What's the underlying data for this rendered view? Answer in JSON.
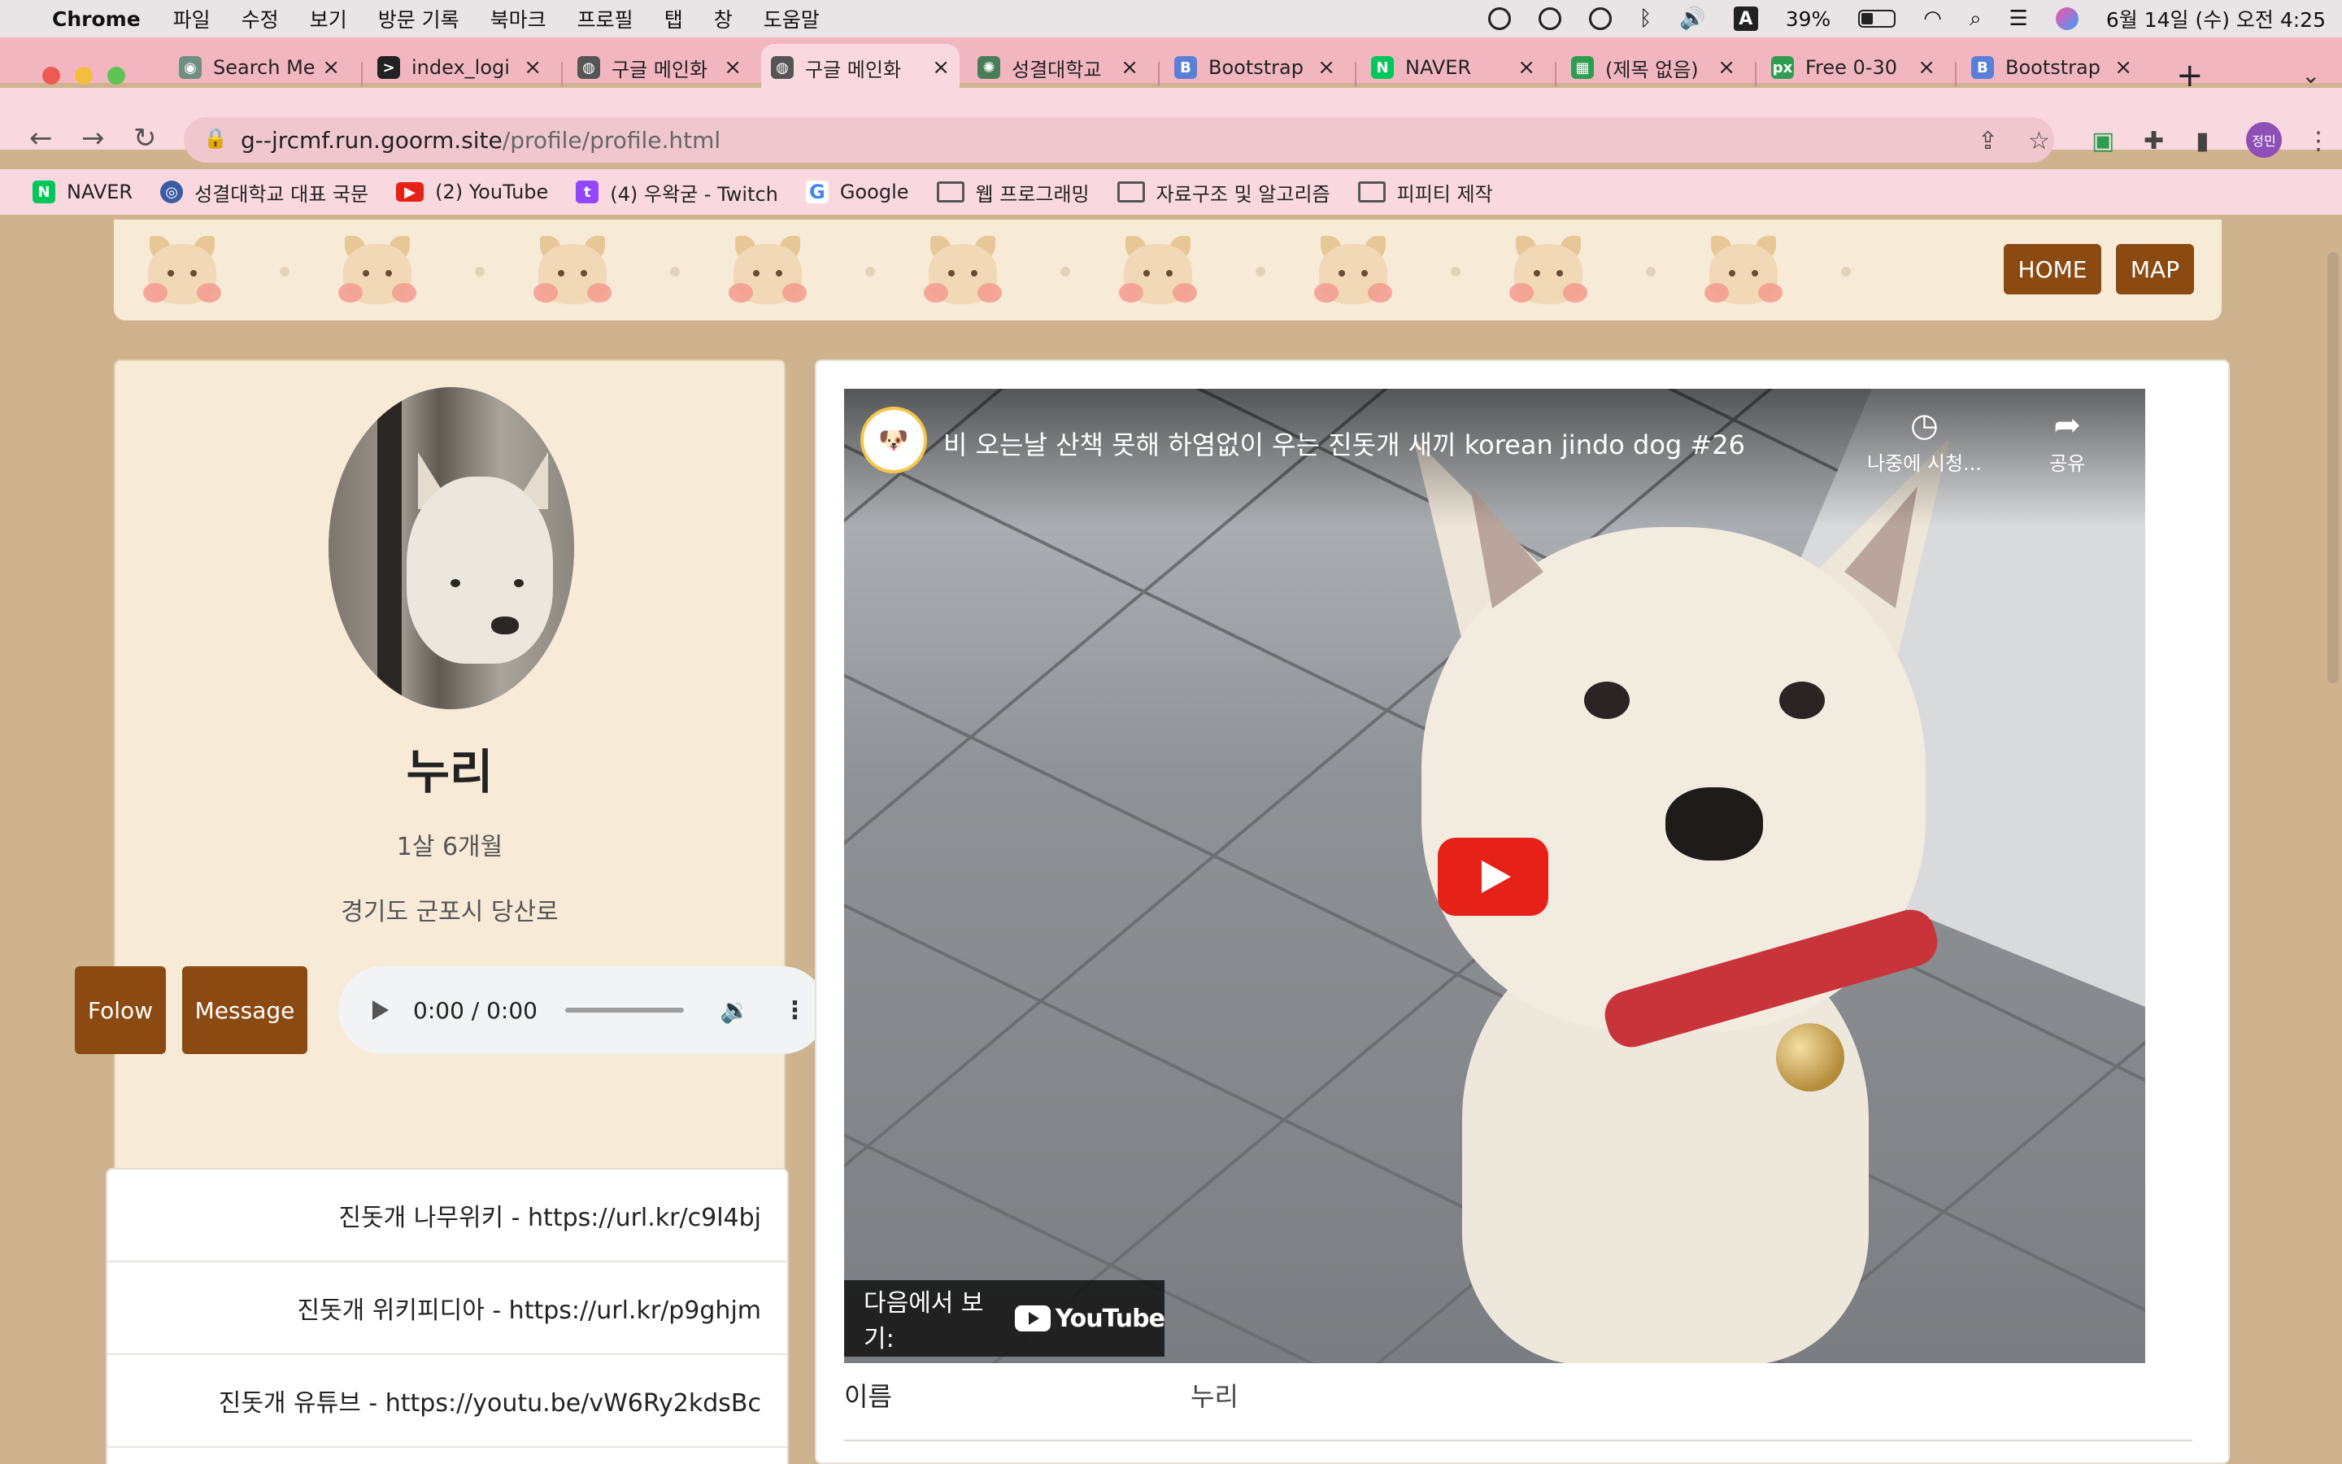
{
  "menubar": {
    "app": "Chrome",
    "items": [
      "파일",
      "수정",
      "보기",
      "방문 기록",
      "북마크",
      "프로필",
      "탭",
      "창",
      "도움말"
    ],
    "battery": "39%",
    "datetime": "6월 14일 (수) 오전 4:25",
    "input_indicator": "A"
  },
  "tabs": [
    {
      "label": "Search Me",
      "icon_color": "#6f8f7f"
    },
    {
      "label": "index_logi",
      "icon_color": "#222222"
    },
    {
      "label": "구글 메인화",
      "icon_color": "#555555"
    },
    {
      "label": "구글 메인화",
      "icon_color": "#555555",
      "active": true
    },
    {
      "label": "성결대학교",
      "icon_color": "#4a7c59"
    },
    {
      "label": "Bootstrap",
      "icon_color": "#5b7fd6"
    },
    {
      "label": "NAVER",
      "icon_color": "#03c75a"
    },
    {
      "label": "(제목 없음)",
      "icon_color": "#2e9d4f"
    },
    {
      "label": "Free 0-30",
      "icon_color": "#2e9d4f"
    },
    {
      "label": "Bootstrap",
      "icon_color": "#5b7fd6"
    }
  ],
  "toolbar": {
    "url_host": "g--jrcmf.run.goorm.site",
    "url_path": "/profile/profile.html",
    "profile_badge": "정민"
  },
  "bookmarks": [
    {
      "label": "NAVER",
      "kind": "site",
      "icon_color": "#03c75a",
      "glyph": "N"
    },
    {
      "label": "성결대학교 대표 국문",
      "kind": "site",
      "icon_color": "#3b5ba5",
      "glyph": "◎"
    },
    {
      "label": "(2) YouTube",
      "kind": "site",
      "icon_color": "#e62117",
      "glyph": "▶"
    },
    {
      "label": "(4) 우왁굳 - Twitch",
      "kind": "site",
      "icon_color": "#9146ff",
      "glyph": "t"
    },
    {
      "label": "Google",
      "kind": "site",
      "icon_color": "#4285f4",
      "glyph": "G"
    },
    {
      "label": "웹 프로그래밍",
      "kind": "folder"
    },
    {
      "label": "자료구조 및 알고리즘",
      "kind": "folder"
    },
    {
      "label": "피피티 제작",
      "kind": "folder"
    }
  ],
  "nav": {
    "home": "HOME",
    "map": "MAP"
  },
  "profile": {
    "name": "누리",
    "age": "1살 6개월",
    "location": "경기도 군포시 당산로",
    "follow_label": "Folow",
    "message_label": "Message"
  },
  "audio": {
    "time": "0:00 / 0:00"
  },
  "links": [
    "진돗개 나무위키 - https://url.kr/c9l4bj",
    "진돗개 위키피디아 - https://url.kr/p9ghjm",
    "진돗개 유튜브 - https://youtu.be/vW6Ry2kdsBc"
  ],
  "video": {
    "title": "비 오는날 산책 못해 하염없이 우는 진돗개 새끼 korean jindo dog #26",
    "watch_later": "나중에 시청...",
    "share": "공유",
    "watch_on": "다음에서 보기:",
    "youtube": "YouTube"
  },
  "info": {
    "label": "이름",
    "value": "누리"
  },
  "colors": {
    "accent_brown": "#8b4a12",
    "page_bg": "#cfb38e",
    "card_bg": "#f7ead7",
    "tab_strip": "#f2b6c0"
  }
}
